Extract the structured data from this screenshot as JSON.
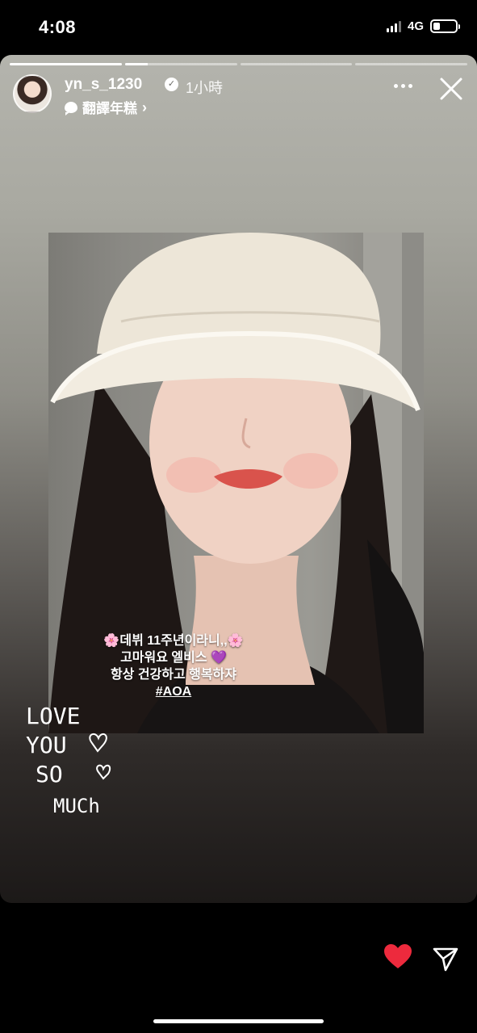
{
  "status_bar": {
    "time": "4:08",
    "network": "4G"
  },
  "story": {
    "progress": [
      1,
      0.2,
      0,
      0
    ],
    "user": {
      "username": "yn_s_1230",
      "time_ago": "1小時",
      "translate_label": "翻譯年糕"
    },
    "caption": {
      "line1": "🌸데뷔 11주년이라니,,🌸",
      "line2": "고마워요 엘비스 💜",
      "line3": "항상 건강하고 행복하쟈",
      "hashtag": "#AOA"
    },
    "handwriting": [
      "LOVE",
      "YOU",
      "SO",
      "MUCh"
    ]
  },
  "colors": {
    "like": "#ed2a3d",
    "background": "#000000"
  },
  "icons": [
    "verified-badge-icon",
    "speech-bubble-icon",
    "chevron-right-icon",
    "more-options-icon",
    "close-icon",
    "heart-icon",
    "send-icon"
  ]
}
